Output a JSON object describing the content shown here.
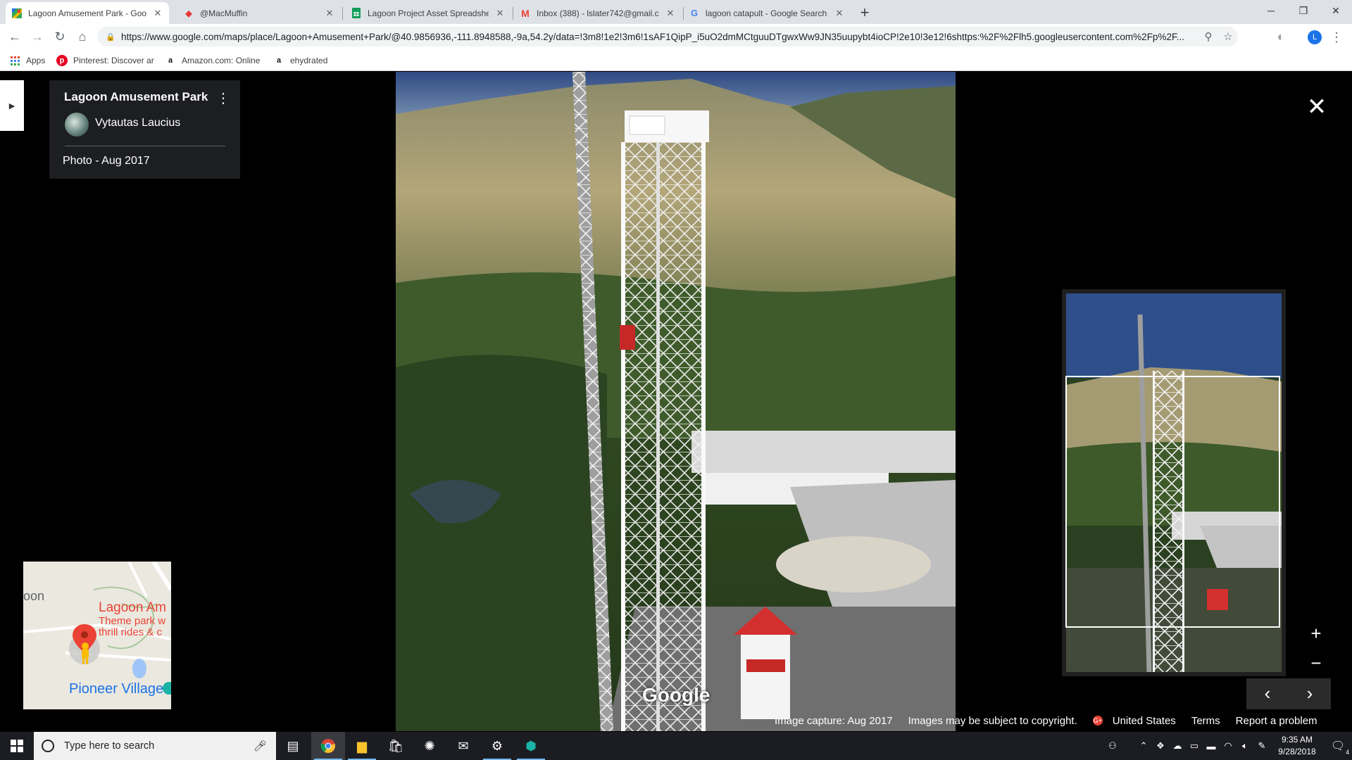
{
  "browser": {
    "tabs": [
      {
        "title": "Lagoon Amusement Park - Goog",
        "icon": "google-maps-icon",
        "active": true
      },
      {
        "title": "@MacMuffin",
        "icon": "roblox-icon",
        "active": false
      },
      {
        "title": "Lagoon Project Asset Spreadshe",
        "icon": "sheets-icon",
        "active": false
      },
      {
        "title": "Inbox (388) - lslater742@gmail.c",
        "icon": "gmail-icon",
        "active": false
      },
      {
        "title": "lagoon catapult - Google Search",
        "icon": "google-icon",
        "active": false
      }
    ],
    "url": "https://www.google.com/maps/place/Lagoon+Amusement+Park/@40.9856936,-111.8948588,-9a,54.2y/data=!3m8!1e2!3m6!1sAF1QipP_i5uO2dmMCtguuDTgwxWw9JN35uupybt4ioCP!2e10!3e12!6shttps:%2F%2Flh5.googleusercontent.com%2Fp%2F...",
    "profile_initial": "L",
    "bookmarks": [
      {
        "label": "Apps",
        "icon": "apps-grid-icon"
      },
      {
        "label": "Pinterest: Discover ar",
        "icon": "pinterest-icon"
      },
      {
        "label": "Amazon.com: Online",
        "icon": "amazon-icon"
      },
      {
        "label": "ehydrated",
        "icon": "amazon-icon"
      }
    ]
  },
  "viewer": {
    "place_name": "Lagoon Amusement Park",
    "author": "Vytautas Laucius",
    "photo_date": "Photo - Aug 2017",
    "watermark": "Google",
    "minimap": {
      "left_text": "oon",
      "pin_label": "Lagoon Am",
      "pin_sub1": "Theme park w",
      "pin_sub2": "thrill rides & c",
      "village": "Pioneer Village"
    },
    "footer": {
      "capture": "Image capture: Aug 2017",
      "copyright": "Images may be subject to copyright.",
      "country": "United States",
      "terms": "Terms",
      "report": "Report a problem"
    }
  },
  "taskbar": {
    "search_placeholder": "Type here to search",
    "time": "9:35 AM",
    "date": "9/28/2018",
    "notification_count": "4"
  },
  "colors": {
    "accent": "#1a73e8",
    "pin": "#ea4335",
    "chrome_tabstrip": "#dee1e6"
  }
}
